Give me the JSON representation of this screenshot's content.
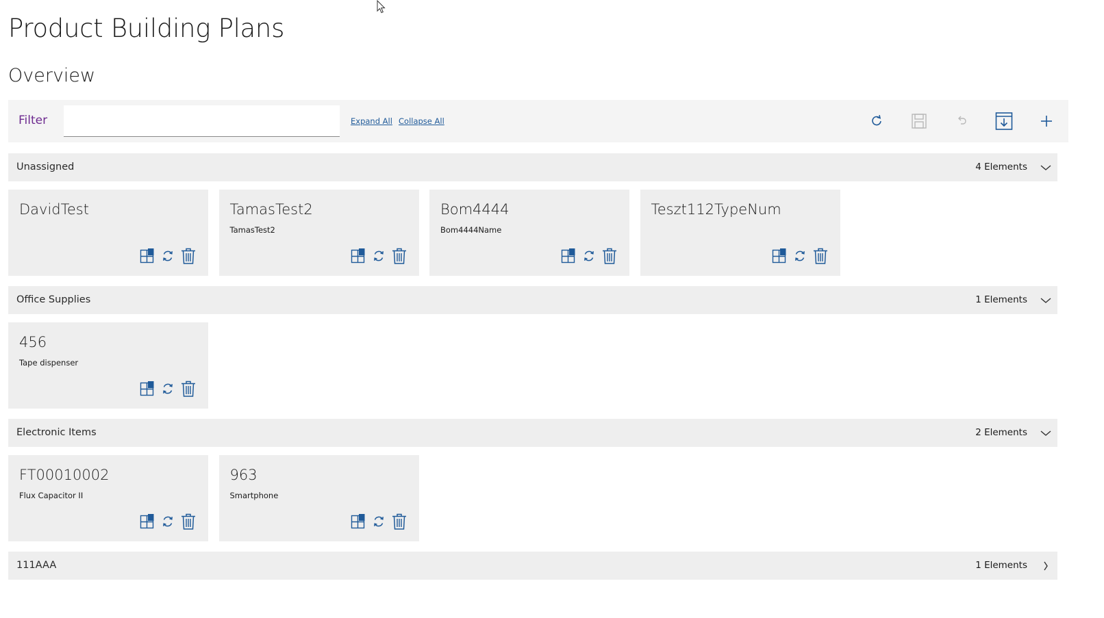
{
  "page": {
    "title": "Product Building Plans",
    "section": "Overview"
  },
  "toolbar": {
    "filter_label": "Filter",
    "filter_value": "",
    "filter_placeholder": "",
    "expand_all": "Expand All",
    "collapse_all": "Collapse All",
    "actions": [
      "refresh-icon",
      "save-icon",
      "undo-icon",
      "download-icon",
      "add-icon"
    ]
  },
  "colors": {
    "accent": "#1f5a99",
    "filter_label": "#6d2a8f",
    "panel": "#eeeeee"
  },
  "groups": [
    {
      "name": "Unassigned",
      "count": "4 Elements",
      "expanded": true,
      "cards": [
        {
          "title": "DavidTest",
          "subtitle": ""
        },
        {
          "title": "TamasTest2",
          "subtitle": "TamasTest2"
        },
        {
          "title": "Bom4444",
          "subtitle": "Bom4444Name"
        },
        {
          "title": "Teszt112TypeNum",
          "subtitle": ""
        }
      ]
    },
    {
      "name": "Office Supplies",
      "count": "1 Elements",
      "expanded": true,
      "cards": [
        {
          "title": "456",
          "subtitle": "Tape dispenser"
        }
      ]
    },
    {
      "name": "Electronic Items",
      "count": "2 Elements",
      "expanded": true,
      "cards": [
        {
          "title": "FT00010002",
          "subtitle": "Flux Capacitor II"
        },
        {
          "title": "963",
          "subtitle": "Smartphone"
        }
      ]
    },
    {
      "name": "111AAA",
      "count": "1 Elements",
      "expanded": false,
      "cards": []
    }
  ],
  "card_actions": [
    "structure-icon",
    "sync-icon",
    "delete-icon"
  ]
}
